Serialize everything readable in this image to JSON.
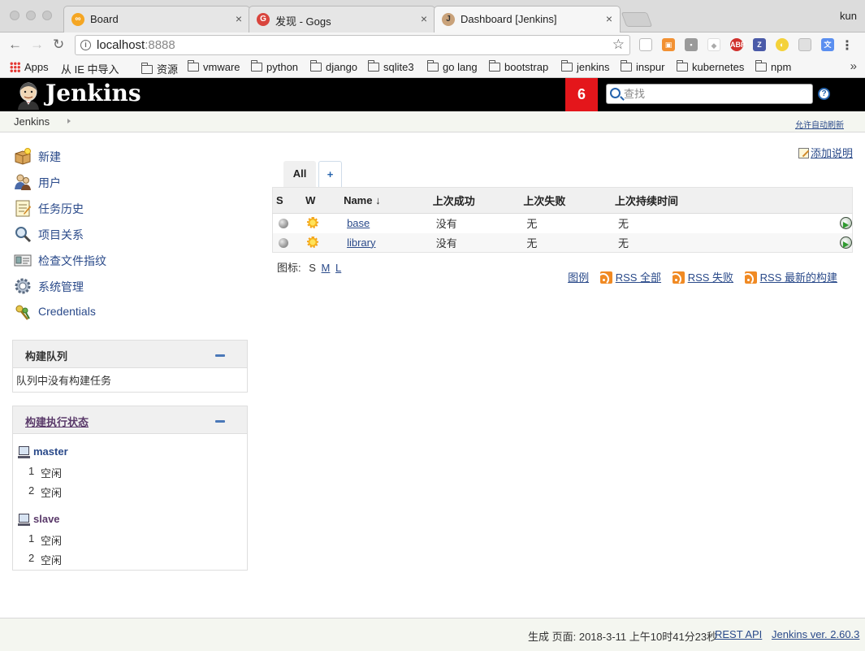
{
  "browser": {
    "tabs": [
      {
        "title": "Board",
        "favicon": "board-icon",
        "active": false
      },
      {
        "title": "发现 - Gogs",
        "favicon": "gogs-icon",
        "active": false
      },
      {
        "title": "Dashboard [Jenkins]",
        "favicon": "jenkins-icon",
        "active": true
      }
    ],
    "close_glyph": "×",
    "profile": "kun",
    "url_host": "localhost",
    "url_port": ":8888",
    "bookmarks": [
      "Apps",
      "从 IE 中导入",
      "资源",
      "vmware",
      "python",
      "django",
      "sqlite3",
      "go lang",
      "bootstrap",
      "jenkins",
      "inspur",
      "kubernetes",
      "npm"
    ],
    "more": "»"
  },
  "header": {
    "title": "Jenkins",
    "notification_count": "6",
    "search_placeholder": "查找",
    "help": "?",
    "accent": "#e4161b"
  },
  "breadcrumb": {
    "root": "Jenkins",
    "auto_refresh": "允许自动刷新"
  },
  "sidebar": {
    "tasks": [
      {
        "label": "新建",
        "icon": "new-item-icon"
      },
      {
        "label": "用户",
        "icon": "people-icon"
      },
      {
        "label": "任务历史",
        "icon": "build-history-icon"
      },
      {
        "label": "项目关系",
        "icon": "project-relationship-icon"
      },
      {
        "label": "检查文件指纹",
        "icon": "fingerprint-icon"
      },
      {
        "label": "系统管理",
        "icon": "manage-jenkins-icon"
      },
      {
        "label": "Credentials",
        "icon": "credentials-icon"
      }
    ],
    "queue": {
      "title": "构建队列",
      "empty": "队列中没有构建任务"
    },
    "executors": {
      "title": "构建执行状态",
      "computers": [
        {
          "name": "master",
          "executors": [
            {
              "num": "1",
              "status": "空闲"
            },
            {
              "num": "2",
              "status": "空闲"
            }
          ]
        },
        {
          "name": "slave",
          "executors": [
            {
              "num": "1",
              "status": "空闲"
            },
            {
              "num": "2",
              "status": "空闲"
            }
          ]
        }
      ]
    }
  },
  "main": {
    "add_description": "添加说明",
    "view_tabs": {
      "all": "All",
      "add": "+"
    },
    "columns": {
      "s": "S",
      "w": "W",
      "name": "Name",
      "sort": "↓",
      "last_success": "上次成功",
      "last_failure": "上次失败",
      "last_duration": "上次持续时间"
    },
    "jobs": [
      {
        "name": "base",
        "last_success": "没有",
        "last_failure": "无",
        "last_duration": "无",
        "status": "grey",
        "weather": "sunny"
      },
      {
        "name": "library",
        "last_success": "没有",
        "last_failure": "无",
        "last_duration": "无",
        "status": "grey",
        "weather": "sunny"
      }
    ],
    "icon_label": "图标:",
    "icon_sizes": {
      "s": "S",
      "m": "M",
      "l": "L"
    },
    "legend": "图例",
    "rss_all": "RSS 全部",
    "rss_failed": "RSS 失败",
    "rss_latest": "RSS 最新的构建"
  },
  "footer": {
    "generated": "生成 页面: 2018-3-11 上午10时41分23秒",
    "rest_api": "REST API",
    "version": "Jenkins ver. 2.60.3"
  }
}
